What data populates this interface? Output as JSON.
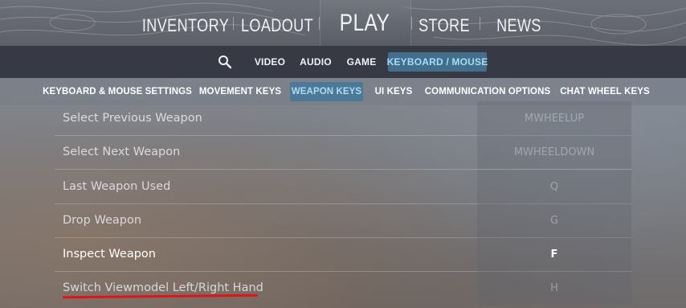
{
  "top_nav": {
    "items": [
      "INVENTORY",
      "LOADOUT",
      "PLAY",
      "STORE",
      "NEWS"
    ]
  },
  "settings_tabs": {
    "items": [
      "VIDEO",
      "AUDIO",
      "GAME",
      "KEYBOARD / MOUSE"
    ],
    "active": "KEYBOARD / MOUSE"
  },
  "category_tabs": {
    "items": [
      "KEYBOARD & MOUSE SETTINGS",
      "MOVEMENT KEYS",
      "WEAPON KEYS",
      "UI KEYS",
      "COMMUNICATION OPTIONS",
      "CHAT WHEEL KEYS"
    ],
    "active": "WEAPON KEYS"
  },
  "bindings": [
    {
      "action": "Select Previous Weapon",
      "key": "MWHEELUP"
    },
    {
      "action": "Select Next Weapon",
      "key": "MWHEELDOWN"
    },
    {
      "action": "Last Weapon Used",
      "key": "Q"
    },
    {
      "action": "Drop Weapon",
      "key": "G"
    },
    {
      "action": "Inspect Weapon",
      "key": "F",
      "highlighted": true
    },
    {
      "action": "Switch Viewmodel Left/Right Hand",
      "key": "H",
      "annotated": true
    }
  ],
  "colors": {
    "active_tab_bg": "#436f8c",
    "active_tab_text": "#a6dcf7",
    "annotation_underline": "#e0141b"
  },
  "icons": {
    "search": "search-icon"
  }
}
